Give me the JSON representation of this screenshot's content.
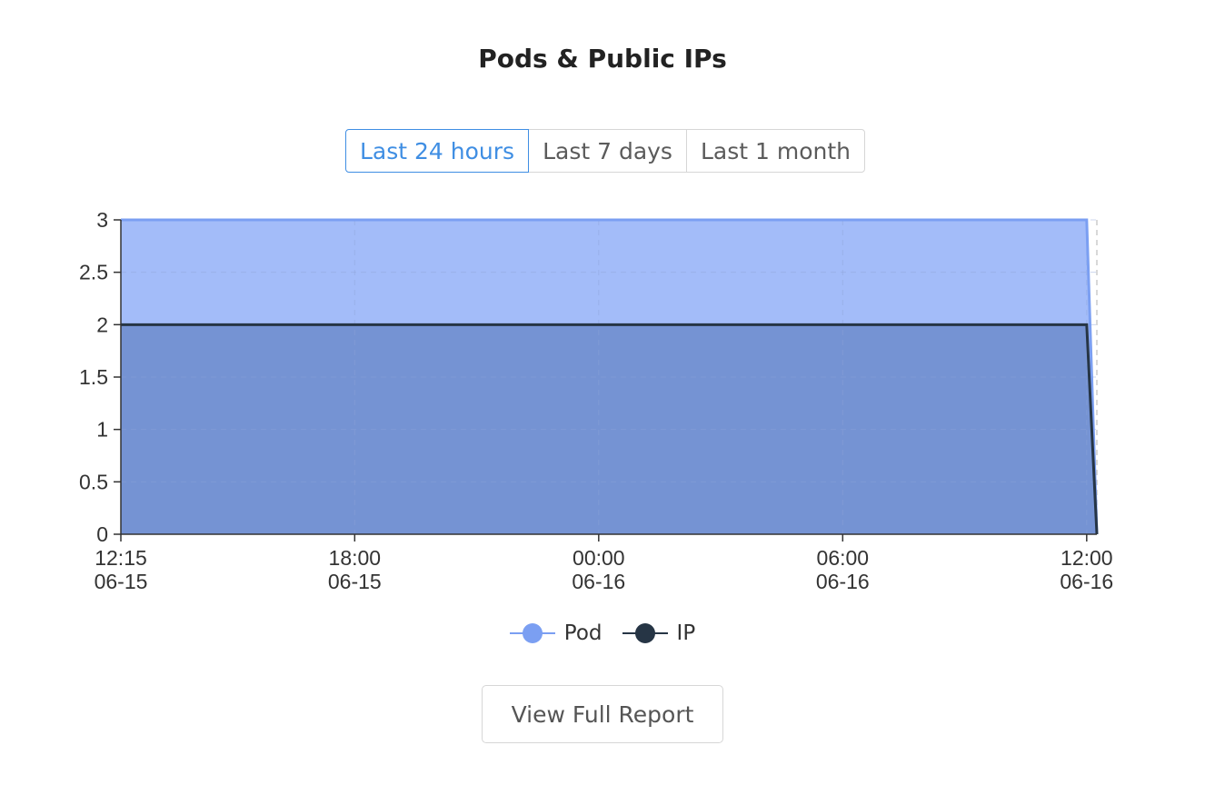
{
  "widget": {
    "title": "Pods & Public IPs",
    "report_button": "View Full Report"
  },
  "range_tabs": [
    {
      "label": "Last 24 hours",
      "active": true
    },
    {
      "label": "Last 7 days",
      "active": false
    },
    {
      "label": "Last 1 month",
      "active": false
    }
  ],
  "colors": {
    "pod_fill": "#a3bcf9",
    "pod_line": "#7b9ff2",
    "ip_fill": "#7593d3",
    "ip_line": "#263545",
    "active_tab": "#3f8ee3"
  },
  "chart_data": {
    "type": "area",
    "y_ticks": [
      "0",
      "0.5",
      "1",
      "1.5",
      "2",
      "2.5",
      "3"
    ],
    "ylim": [
      0,
      3
    ],
    "x_ticks": [
      {
        "time": "12:15",
        "date": "06-15"
      },
      {
        "time": "18:00",
        "date": "06-15"
      },
      {
        "time": "00:00",
        "date": "06-16"
      },
      {
        "time": "06:00",
        "date": "06-16"
      },
      {
        "time": "12:00",
        "date": "06-16"
      }
    ],
    "x_tick_hours": [
      0,
      5.75,
      11.75,
      17.75,
      23.75
    ],
    "xlim_hours": [
      0,
      24
    ],
    "grid": true,
    "legend": "bottom",
    "series": [
      {
        "name": "Pod",
        "points": [
          [
            0,
            3
          ],
          [
            23.75,
            3
          ],
          [
            24,
            0
          ]
        ]
      },
      {
        "name": "IP",
        "points": [
          [
            0,
            2
          ],
          [
            23.75,
            2
          ],
          [
            24,
            0
          ]
        ]
      }
    ]
  }
}
